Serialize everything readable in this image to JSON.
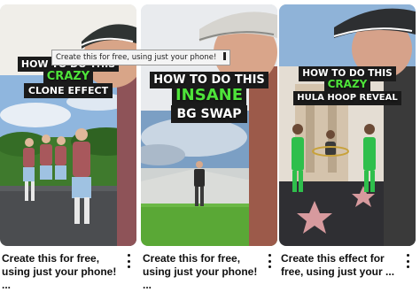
{
  "tooltip": {
    "text": "Create this for free, using just your phone!"
  },
  "videos": [
    {
      "overlay": [
        "HOW TO DO THIS",
        "CRAZY",
        "CLONE EFFECT"
      ],
      "title": "Create this for free,\nusing just your phone! ..."
    },
    {
      "overlay": [
        "HOW TO DO THIS",
        "INSANE",
        "BG SWAP"
      ],
      "title": "Create this for free,\nusing just your phone! ..."
    },
    {
      "overlay": [
        "HOW TO DO THIS",
        "CRAZY",
        "HULA HOOP REVEAL"
      ],
      "title": "Create this effect for\nfree, using just your ..."
    }
  ],
  "colors": {
    "accent_green": "#4ee33a",
    "title_text": "#0f0f0f"
  },
  "icons": {
    "more": "more-vertical-icon"
  }
}
